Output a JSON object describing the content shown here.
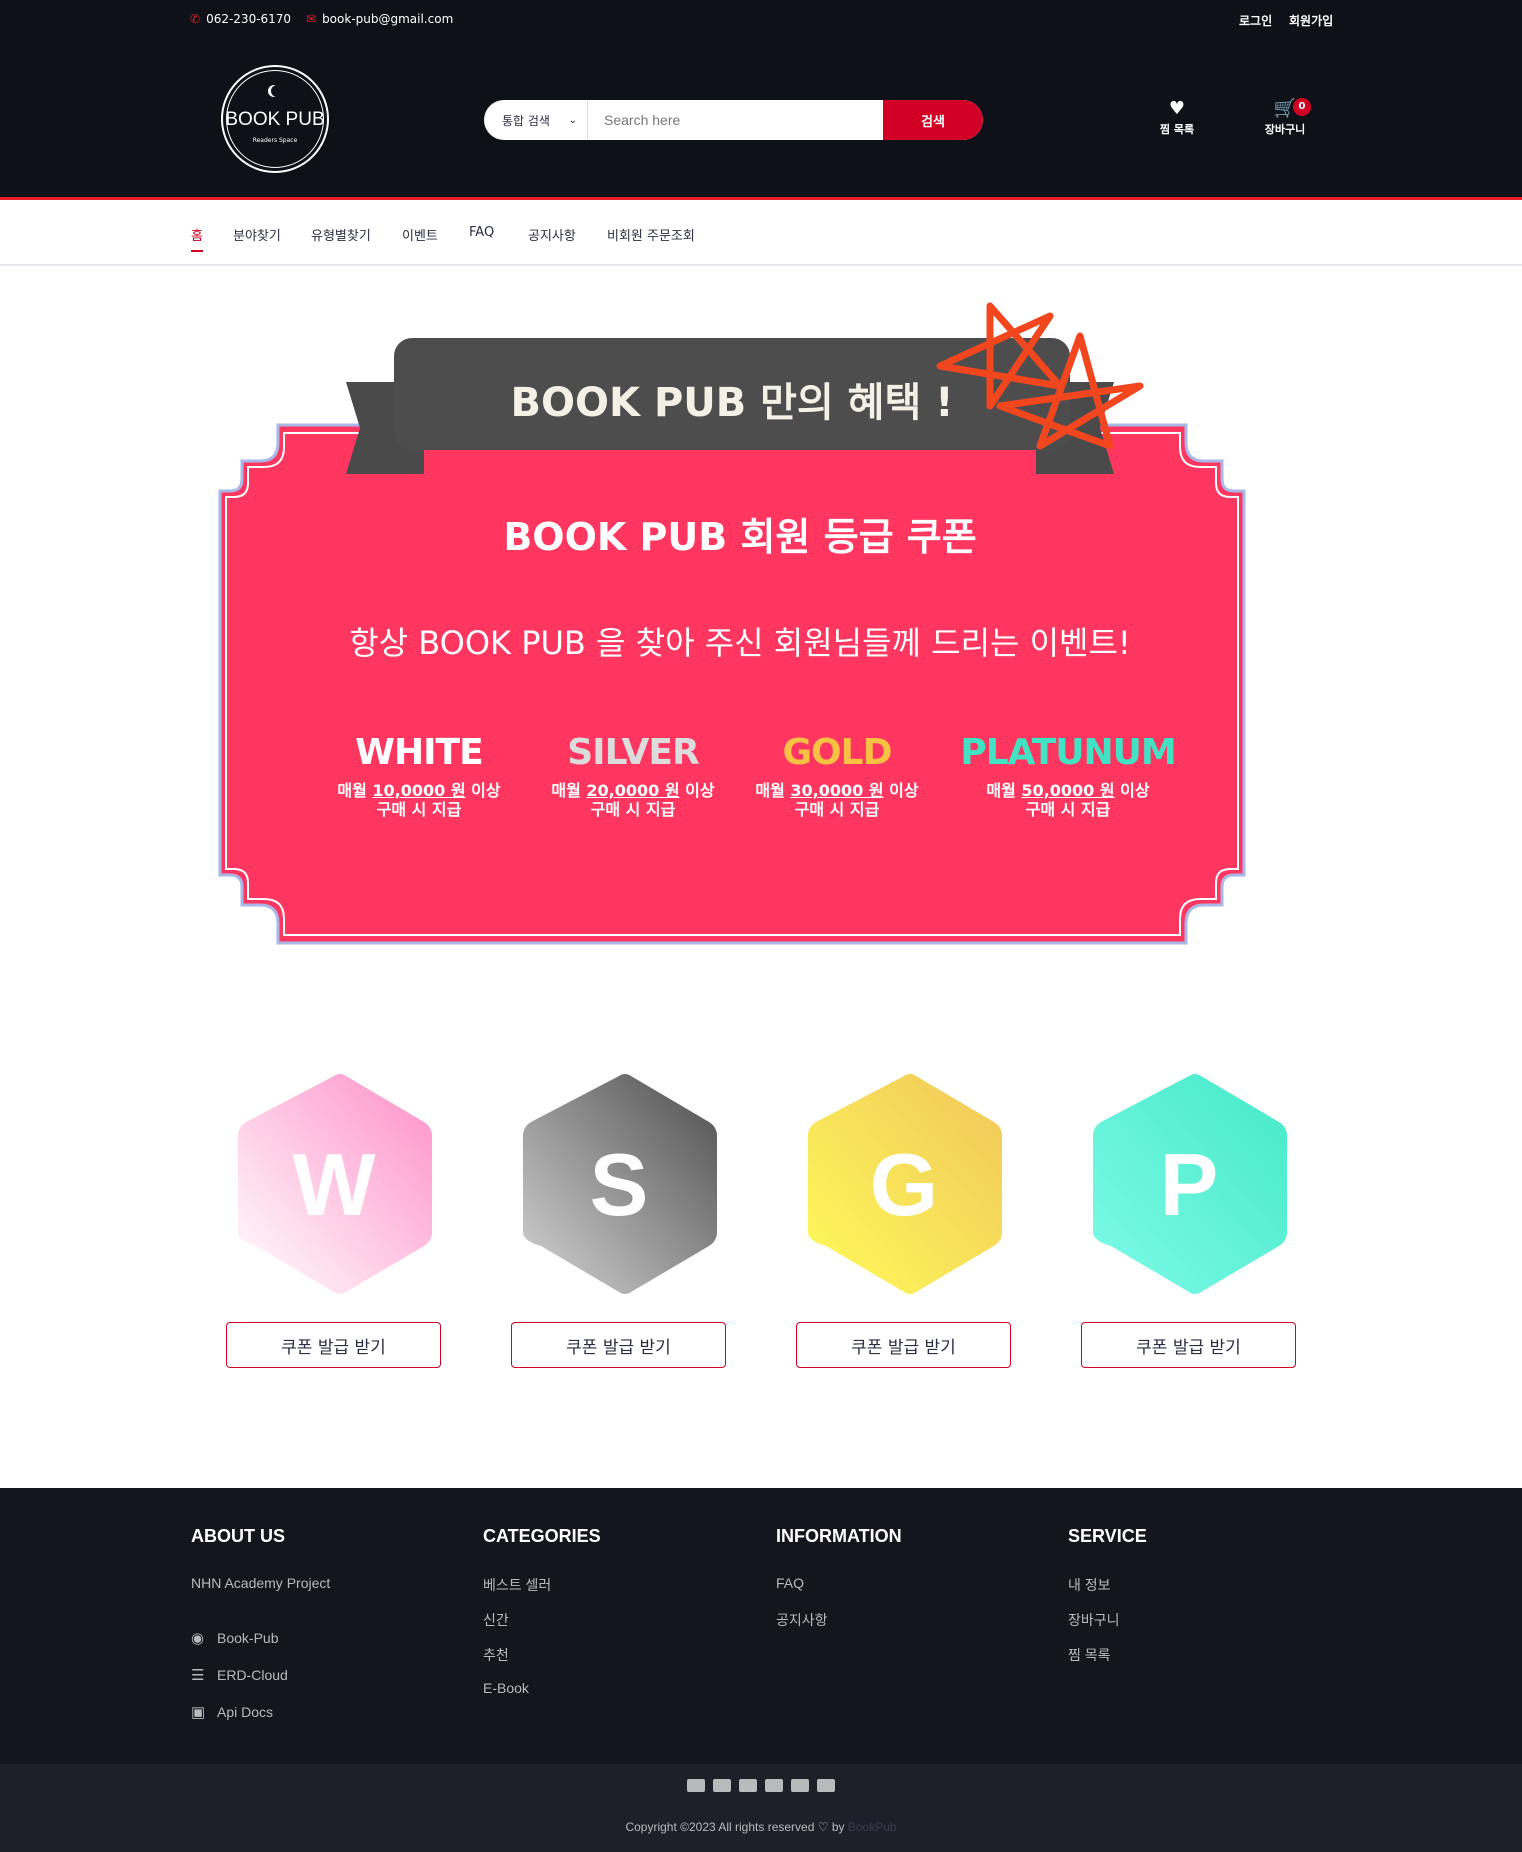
{
  "topbar": {
    "phone": "062-230-6170",
    "email": "book-pub@gmail.com",
    "login": "로그인",
    "signup": "회원가입"
  },
  "header": {
    "logo_name": "BOOK PUB",
    "logo_tagline": "Readers Space",
    "search_category": "통합 검색",
    "search_placeholder": "Search here",
    "search_button": "검색",
    "wishlist_label": "찜 목록",
    "cart_label": "장바구니",
    "cart_count": "0"
  },
  "nav": {
    "items": [
      "홈",
      "분야찾기",
      "유형별찾기",
      "이벤트",
      "FAQ",
      "공지사항",
      "비회원 주문조회"
    ]
  },
  "banner": {
    "ribbon_title": "BOOK PUB 만의 혜택 !",
    "title": "BOOK PUB 회원 등급 쿠폰",
    "subtitle": "항상 BOOK PUB 을 찾아 주신 회원님들께 드리는 이벤트!",
    "tiers": [
      {
        "name": "WHITE",
        "color": "#ffffff",
        "prefix": "매월 ",
        "amount": "10,0000 원",
        "suffix": " 이상",
        "line2": "구매 시 지급"
      },
      {
        "name": "SILVER",
        "color": "#dcdcdc",
        "prefix": "매월 ",
        "amount": "20,0000 원",
        "suffix": " 이상",
        "line2": "구매 시 지급"
      },
      {
        "name": "GOLD",
        "color": "#f7c244",
        "prefix": "매월 ",
        "amount": "30,0000 원",
        "suffix": " 이상",
        "line2": "구매 시 지급"
      },
      {
        "name": "PLATUNUM",
        "color": "#41e3c4",
        "prefix": "매월 ",
        "amount": "50,0000 원",
        "suffix": " 이상",
        "line2": "구매 시 지급"
      }
    ]
  },
  "coupons": [
    {
      "letter": "W",
      "button": "쿠폰 발급 받기",
      "grad_top": "#ff8fc8",
      "grad_bottom": "#ffffff"
    },
    {
      "letter": "S",
      "button": "쿠폰 발급 받기",
      "grad_top": "#4d4d4d",
      "grad_bottom": "#d6d6d6"
    },
    {
      "letter": "G",
      "button": "쿠폰 발급 받기",
      "grad_top": "#f0c65a",
      "grad_bottom": "#fffb5a"
    },
    {
      "letter": "P",
      "button": "쿠폰 발급 받기",
      "grad_top": "#45e8c8",
      "grad_bottom": "#7efbe8"
    }
  ],
  "footer": {
    "about": {
      "title": "ABOUT US",
      "text": "NHN Academy Project",
      "links": [
        {
          "icon": "github-icon",
          "label": "Book-Pub"
        },
        {
          "icon": "database-icon",
          "label": "ERD-Cloud"
        },
        {
          "icon": "book-icon",
          "label": "Api Docs"
        }
      ]
    },
    "categories": {
      "title": "CATEGORIES",
      "links": [
        "베스트 셀러",
        "신간",
        "추천",
        "E-Book"
      ]
    },
    "information": {
      "title": "INFORMATION",
      "links": [
        "FAQ",
        "공지사항"
      ]
    },
    "service": {
      "title": "SERVICE",
      "links": [
        "내 정보",
        "장바구니",
        "찜 목록"
      ]
    },
    "copyright": "Copyright ©2023 All rights reserved ♡ by",
    "brand": "BookPub"
  }
}
